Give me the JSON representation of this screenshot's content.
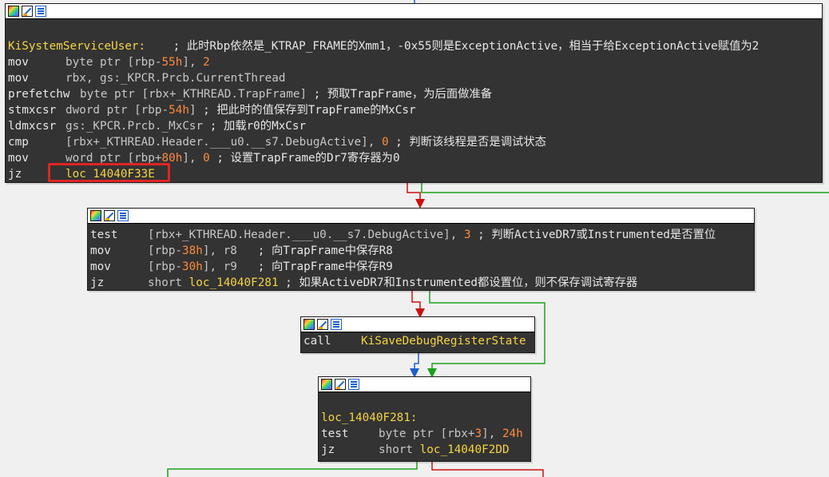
{
  "node1": {
    "label": "KiSystemServiceUser:",
    "label_comment": "; 此时Rbp依然是_KTRAP_FRAME的Xmm1，-0x55则是ExceptionActive，相当于给ExceptionActive赋值为2",
    "l2": {
      "m": "mov",
      "a": "byte ptr [rbp-",
      "b": "55h",
      "c": "], ",
      "d": "2"
    },
    "l3": {
      "m": "mov",
      "a": "rbx, gs:_KPCR.Prcb.CurrentThread"
    },
    "l4": {
      "m": "prefetchw",
      "a": "byte ptr [rbx+_KTHREAD.TrapFrame] ",
      "cmt": "; 预取TrapFrame，为后面做准备"
    },
    "l5": {
      "m": "stmxcsr",
      "a": "dword ptr [rbp-",
      "b": "54h",
      "c": "] ",
      "cmt": "; 把此时的值保存到TrapFrame的MxCsr"
    },
    "l6": {
      "m": "ldmxcsr",
      "a": "gs:_KPCR.Prcb._MxCsr ",
      "cmt": "; 加载r0的MxCsr"
    },
    "l7": {
      "m": "cmp",
      "a": "[rbx+_KTHREAD.Header.___u0.__s7.DebugActive], ",
      "b": "0",
      "cmt": " ; 判断该线程是否是调试状态"
    },
    "l8": {
      "m": "mov",
      "a": "word ptr [rbp+",
      "b": "80h",
      "c": "], ",
      "d": "0",
      "cmt": " ; 设置TrapFrame的Dr7寄存器为0"
    },
    "l9": {
      "m": "jz",
      "a": "loc_14040F33E"
    }
  },
  "node2": {
    "l1": {
      "m": "test",
      "a": "[rbx+_KTHREAD.Header.___u0.__s7.DebugActive], ",
      "b": "3",
      "cmt": " ; 判断ActiveDR7或Instrumented是否置位"
    },
    "l2": {
      "m": "mov",
      "a": "[rbp-",
      "b": "38h",
      "c": "], r8   ",
      "cmt": "; 向TrapFrame中保存R8"
    },
    "l3": {
      "m": "mov",
      "a": "[rbp-",
      "b": "30h",
      "c": "], r9   ",
      "cmt": "; 向TrapFrame中保存R9"
    },
    "l4": {
      "m": "jz",
      "a": "short ",
      "s": "loc_14040F281",
      "cmt": " ; 如果ActiveDR7和Instrumented都设置位，则不保存调试寄存器"
    }
  },
  "node3": {
    "l1": {
      "m": "call",
      "a": "KiSaveDebugRegisterState"
    }
  },
  "node4": {
    "label": "loc_14040F281:",
    "l2": {
      "m": "test",
      "a": "byte ptr [rbx+",
      "b": "3",
      "c": "], ",
      "d": "24h"
    },
    "l3": {
      "m": "jz",
      "a": "short ",
      "s": "loc_14040F2DD"
    }
  },
  "colors": {
    "edge_true": "#1aa11a",
    "edge_false": "#cc1111",
    "edge_uncond": "#1e5fd0",
    "highlight": "#e02424"
  },
  "icons": [
    "palette-icon",
    "edit-node-icon",
    "graph-layout-icon"
  ]
}
